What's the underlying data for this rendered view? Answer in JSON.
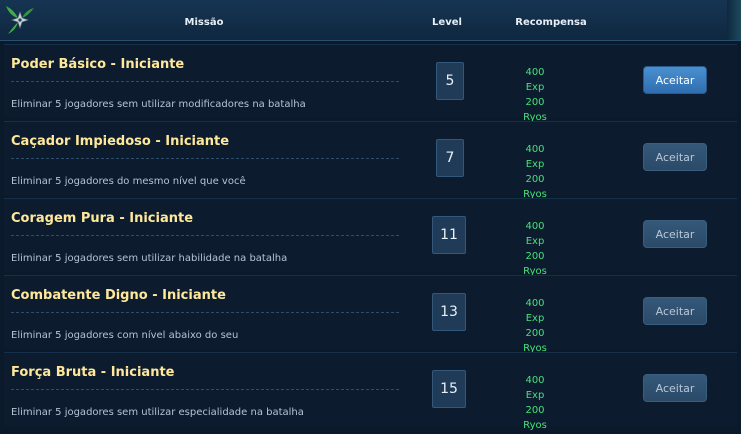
{
  "header": {
    "col_mission": "Missão",
    "col_level": "Level",
    "col_reward": "Recompensa"
  },
  "missions": [
    {
      "title": "Poder Básico - Iniciante",
      "description": "Eliminar 5 jogadores sem utilizar modificadores na batalha",
      "level": "5",
      "reward_exp": "400 Exp",
      "reward_ryos": "200 Ryos",
      "button": "Aceitar",
      "button_enabled": true
    },
    {
      "title": "Caçador Impiedoso - Iniciante",
      "description": "Eliminar 5 jogadores do mesmo nível que você",
      "level": "7",
      "reward_exp": "400 Exp",
      "reward_ryos": "200 Ryos",
      "button": "Aceitar",
      "button_enabled": false
    },
    {
      "title": "Coragem Pura - Iniciante",
      "description": "Eliminar 5 jogadores sem utilizar habilidade na batalha",
      "level": "11",
      "reward_exp": "400 Exp",
      "reward_ryos": "200 Ryos",
      "button": "Aceitar",
      "button_enabled": false
    },
    {
      "title": "Combatente Digno - Iniciante",
      "description": "Eliminar 5 jogadores com nível abaixo do seu",
      "level": "13",
      "reward_exp": "400 Exp",
      "reward_ryos": "200 Ryos",
      "button": "Aceitar",
      "button_enabled": false
    },
    {
      "title": "Força Bruta - Iniciante",
      "description": "Eliminar 5 jogadores sem utilizar especialidade na batalha",
      "level": "15",
      "reward_exp": "400 Exp",
      "reward_ryos": "200 Ryos",
      "button": "Aceitar",
      "button_enabled": false
    }
  ],
  "icons": {
    "header_decoration": "leaf-shuriken-icon"
  },
  "colors": {
    "title": "#ffe89a",
    "reward": "#47e07a",
    "button_active": "#4a90d0",
    "button_disabled": "#355879"
  }
}
